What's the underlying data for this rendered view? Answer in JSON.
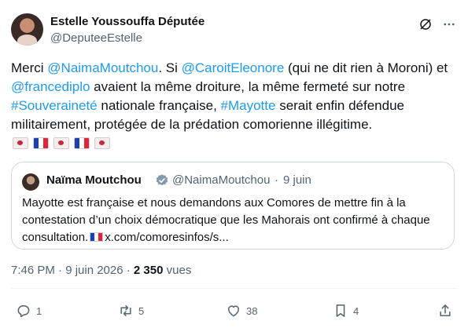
{
  "author": {
    "name": "Estelle Youssouffa Députée",
    "handle": "@DeputeeEstelle"
  },
  "tweet": {
    "line1_pre": "Merci ",
    "mention_naima": "@NaimaMoutchou",
    "line1_mid": ". Si ",
    "mention_caroit": "@CaroitEleonore",
    "line1_post": " (qui ne dit rien à Moroni) et",
    "mention_francediplo": "@francediplo",
    "line2_post": " avaient la même droiture, la même fermeté sur notre",
    "hashtag_souverainete": "#Souveraineté",
    "line3_mid": " nationale française, ",
    "hashtag_mayotte": "#Mayotte",
    "line3_post": " serait enfin défendue",
    "line4": "militairement, protégée de la prédation comorienne illégitime."
  },
  "quote": {
    "name": "Naïma Moutchou",
    "handle": "@NaimaMoutchou",
    "dot": "·",
    "date": "9 juin",
    "text_line1": "Mayotte est française et nous demandons aux Comores de mettre fin à la",
    "text_line2": "contestation d’un choix démocratique que les Mahorais ont confirmé à chaque",
    "text_line3": "consultation.",
    "link": "x.com/comoresinfos/s..."
  },
  "meta": {
    "time_date": "7:46 PM · 9 juin 2026 · ",
    "views": "2 350",
    "views_label": " vues"
  },
  "actions": {
    "replies": "1",
    "reposts": "5",
    "likes": "38",
    "bookmarks": "4"
  },
  "colors": {
    "link": "#1d9bf0",
    "secondary": "#536471",
    "verified": "#829aab"
  }
}
